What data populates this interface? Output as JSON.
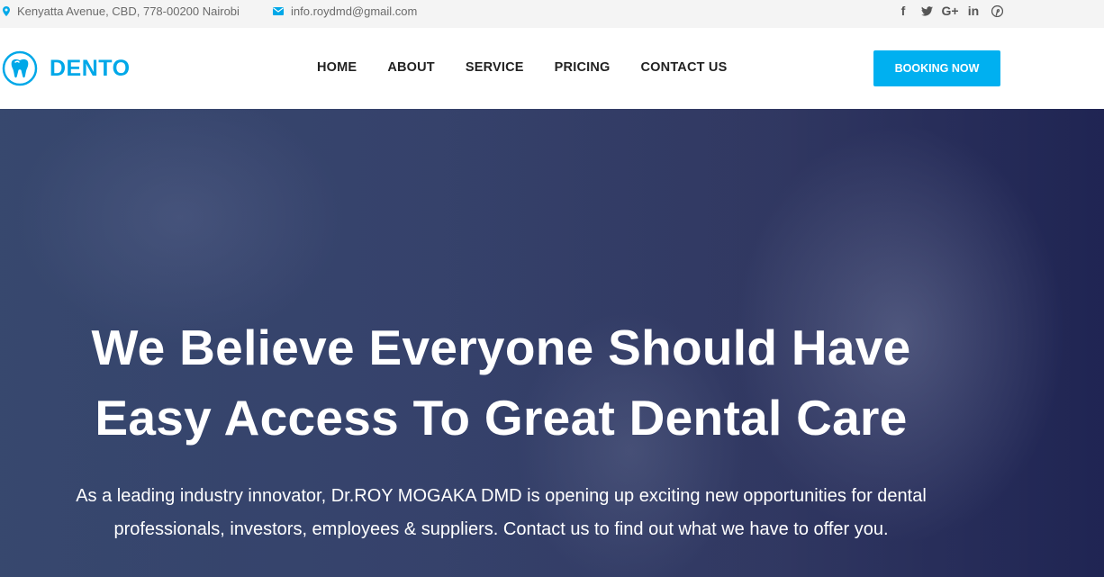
{
  "topbar": {
    "address": "Kenyatta Avenue, CBD, 778-00200 Nairobi",
    "email": "info.roydmd@gmail.com",
    "socials": [
      {
        "icon": "facebook-icon",
        "glyph": "f"
      },
      {
        "icon": "twitter-icon",
        "glyph": "𝕥"
      },
      {
        "icon": "google-plus-icon",
        "glyph": "G+"
      },
      {
        "icon": "linkedin-icon",
        "glyph": "in"
      },
      {
        "icon": "pinterest-icon",
        "glyph": "℗"
      }
    ]
  },
  "navbar": {
    "logo_text": "DENTO",
    "menu": [
      "HOME",
      "ABOUT",
      "SERVICE",
      "PRICING",
      "CONTACT US"
    ],
    "booking_label": "BOOKING NOW"
  },
  "hero": {
    "title_line1": "We Believe Everyone Should Have",
    "title_line2": "Easy Access To Great Dental Care",
    "text_line1": "As a leading industry innovator, Dr.ROY MOGAKA DMD is opening up exciting new opportunities for dental",
    "text_line2": "professionals, investors, employees & suppliers. Contact us to find out what we have to offer you."
  },
  "colors": {
    "accent": "#00a8e8",
    "button": "#00b0f0",
    "hero_overlay": "#3a4670"
  }
}
